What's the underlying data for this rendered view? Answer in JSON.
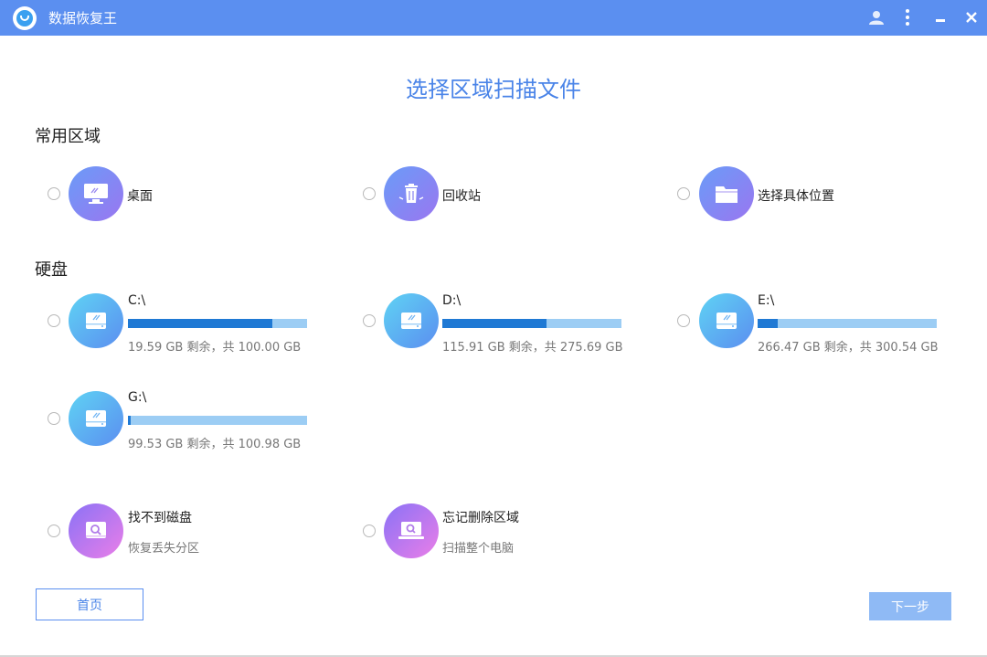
{
  "app": {
    "title": "数据恢复王"
  },
  "page": {
    "title": "选择区域扫描文件"
  },
  "sections": {
    "common": "常用区域",
    "disks": "硬盘"
  },
  "common_items": [
    {
      "label": "桌面",
      "icon": "desktop-icon"
    },
    {
      "label": "回收站",
      "icon": "recycle-bin-icon"
    },
    {
      "label": "选择具体位置",
      "icon": "folder-icon"
    }
  ],
  "disks": [
    {
      "label": "C:\\",
      "info": "19.59 GB 剩余，共 100.00 GB",
      "used_fraction": 0.804
    },
    {
      "label": "D:\\",
      "info": "115.91 GB 剩余，共 275.69 GB",
      "used_fraction": 0.58
    },
    {
      "label": "E:\\",
      "info": "266.47 GB 剩余，共 300.54 GB",
      "used_fraction": 0.113
    },
    {
      "label": "G:\\",
      "info": "99.53 GB 剩余，共 100.98 GB",
      "used_fraction": 0.014
    }
  ],
  "extra_items": [
    {
      "label": "找不到磁盘",
      "sub": "恢复丢失分区",
      "icon": "lost-partition-icon"
    },
    {
      "label": "忘记删除区域",
      "sub": "扫描整个电脑",
      "icon": "scan-computer-icon"
    }
  ],
  "buttons": {
    "home": "首页",
    "next": "下一步"
  },
  "colors": {
    "titlebar": "#5b8ff0",
    "accent": "#4a84e8",
    "bar_fill": "#1f79d4",
    "bar_track": "#9ccdf4"
  }
}
